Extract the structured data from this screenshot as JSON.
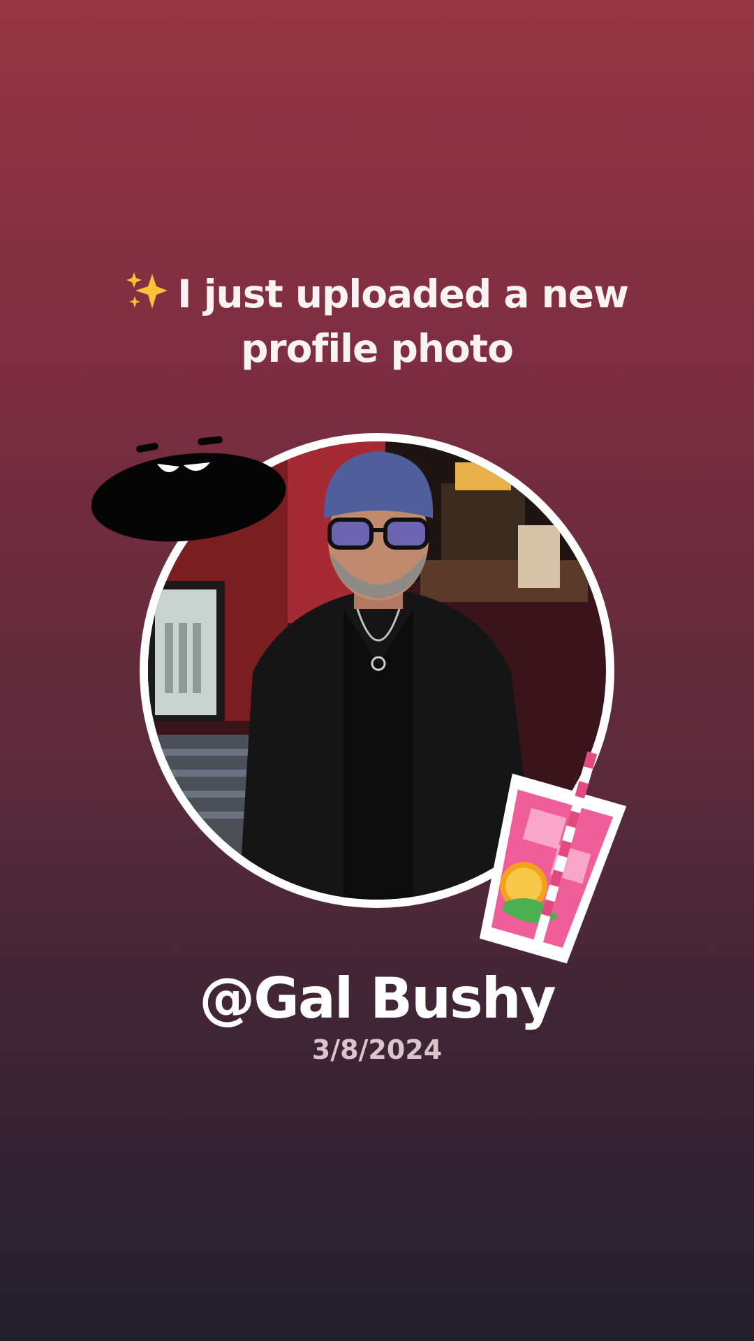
{
  "post": {
    "headline_line1": "I just uploaded a new",
    "headline_line2": "profile photo",
    "headline_icon": "sparkles-icon",
    "username": "@Gal Bushy",
    "date": "3/8/2024"
  },
  "stickers": {
    "top_left": "laughing-mouth-sticker",
    "bottom_right": "pink-lemonade-drink-sticker"
  },
  "colors": {
    "background_top": "#963545",
    "background_bottom": "#23202e",
    "text": "#ffffff",
    "date_text": "#d9c6cd"
  }
}
